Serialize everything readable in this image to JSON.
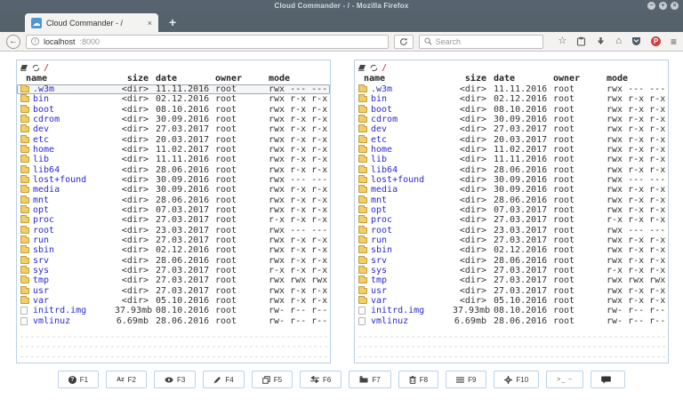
{
  "window": {
    "title": "Cloud Commander - / - Mozilla Firefox",
    "controls": {
      "minimize": "−",
      "maximize": "+",
      "close": "×"
    }
  },
  "browser": {
    "tab": {
      "favicon_glyph": "☁",
      "title": "Cloud Commander - /",
      "close_glyph": "×",
      "new_tab_glyph": "+"
    },
    "toolbar": {
      "back_glyph": "←",
      "info_glyph": "i",
      "url_host": "localhost",
      "url_port": ":8000",
      "search_placeholder": "Search",
      "star_glyph": "☆",
      "home_glyph": "⌂",
      "pocket_red_glyph": "P",
      "menu_glyph": "≡"
    }
  },
  "app": {
    "accent_border_color": "#b9cfe6",
    "link_color": "#2a2ad0",
    "path": "/",
    "columns": [
      "name",
      "size",
      "date",
      "owner",
      "mode"
    ],
    "panels": {
      "left": {
        "selected_index": 0
      },
      "right": {
        "selected_index": null
      }
    },
    "rows": [
      {
        "name": ".w3m",
        "size": "<dir>",
        "date": "11.11.2016",
        "owner": "root",
        "mode": "rwx --- ---",
        "type": "dir"
      },
      {
        "name": "bin",
        "size": "<dir>",
        "date": "02.12.2016",
        "owner": "root",
        "mode": "rwx r-x r-x",
        "type": "dir"
      },
      {
        "name": "boot",
        "size": "<dir>",
        "date": "08.10.2016",
        "owner": "root",
        "mode": "rwx r-x r-x",
        "type": "dir"
      },
      {
        "name": "cdrom",
        "size": "<dir>",
        "date": "30.09.2016",
        "owner": "root",
        "mode": "rwx r-x r-x",
        "type": "dir"
      },
      {
        "name": "dev",
        "size": "<dir>",
        "date": "27.03.2017",
        "owner": "root",
        "mode": "rwx r-x r-x",
        "type": "dir"
      },
      {
        "name": "etc",
        "size": "<dir>",
        "date": "20.03.2017",
        "owner": "root",
        "mode": "rwx r-x r-x",
        "type": "dir"
      },
      {
        "name": "home",
        "size": "<dir>",
        "date": "11.02.2017",
        "owner": "root",
        "mode": "rwx r-x r-x",
        "type": "dir"
      },
      {
        "name": "lib",
        "size": "<dir>",
        "date": "11.11.2016",
        "owner": "root",
        "mode": "rwx r-x r-x",
        "type": "dir"
      },
      {
        "name": "lib64",
        "size": "<dir>",
        "date": "28.06.2016",
        "owner": "root",
        "mode": "rwx r-x r-x",
        "type": "dir"
      },
      {
        "name": "lost+found",
        "size": "<dir>",
        "date": "30.09.2016",
        "owner": "root",
        "mode": "rwx --- ---",
        "type": "dir"
      },
      {
        "name": "media",
        "size": "<dir>",
        "date": "30.09.2016",
        "owner": "root",
        "mode": "rwx r-x r-x",
        "type": "dir"
      },
      {
        "name": "mnt",
        "size": "<dir>",
        "date": "28.06.2016",
        "owner": "root",
        "mode": "rwx r-x r-x",
        "type": "dir"
      },
      {
        "name": "opt",
        "size": "<dir>",
        "date": "07.03.2017",
        "owner": "root",
        "mode": "rwx r-x r-x",
        "type": "dir"
      },
      {
        "name": "proc",
        "size": "<dir>",
        "date": "27.03.2017",
        "owner": "root",
        "mode": "r-x r-x r-x",
        "type": "dir"
      },
      {
        "name": "root",
        "size": "<dir>",
        "date": "23.03.2017",
        "owner": "root",
        "mode": "rwx --- ---",
        "type": "dir"
      },
      {
        "name": "run",
        "size": "<dir>",
        "date": "27.03.2017",
        "owner": "root",
        "mode": "rwx r-x r-x",
        "type": "dir"
      },
      {
        "name": "sbin",
        "size": "<dir>",
        "date": "02.12.2016",
        "owner": "root",
        "mode": "rwx r-x r-x",
        "type": "dir"
      },
      {
        "name": "srv",
        "size": "<dir>",
        "date": "28.06.2016",
        "owner": "root",
        "mode": "rwx r-x r-x",
        "type": "dir"
      },
      {
        "name": "sys",
        "size": "<dir>",
        "date": "27.03.2017",
        "owner": "root",
        "mode": "r-x r-x r-x",
        "type": "dir"
      },
      {
        "name": "tmp",
        "size": "<dir>",
        "date": "27.03.2017",
        "owner": "root",
        "mode": "rwx rwx rwx",
        "type": "dir"
      },
      {
        "name": "usr",
        "size": "<dir>",
        "date": "27.03.2017",
        "owner": "root",
        "mode": "rwx r-x r-x",
        "type": "dir"
      },
      {
        "name": "var",
        "size": "<dir>",
        "date": "05.10.2016",
        "owner": "root",
        "mode": "rwx r-x r-x",
        "type": "dir"
      },
      {
        "name": "initrd.img",
        "size": "37.93mb",
        "date": "08.10.2016",
        "owner": "root",
        "mode": "rw- r-- r--",
        "type": "file"
      },
      {
        "name": "vmlinuz",
        "size": "6.69mb",
        "date": "28.06.2016",
        "owner": "root",
        "mode": "rw- r-- r--",
        "type": "file"
      }
    ]
  },
  "footer": {
    "buttons": [
      {
        "label": "F1"
      },
      {
        "label": "F2"
      },
      {
        "label": "F3"
      },
      {
        "label": "F4"
      },
      {
        "label": "F5"
      },
      {
        "label": "F6"
      },
      {
        "label": "F7"
      },
      {
        "label": "F8"
      },
      {
        "label": "F9"
      },
      {
        "label": "F10"
      },
      {
        "label": ">_ ~"
      },
      {
        "label": ""
      }
    ],
    "rename_icon_text": "Az"
  }
}
